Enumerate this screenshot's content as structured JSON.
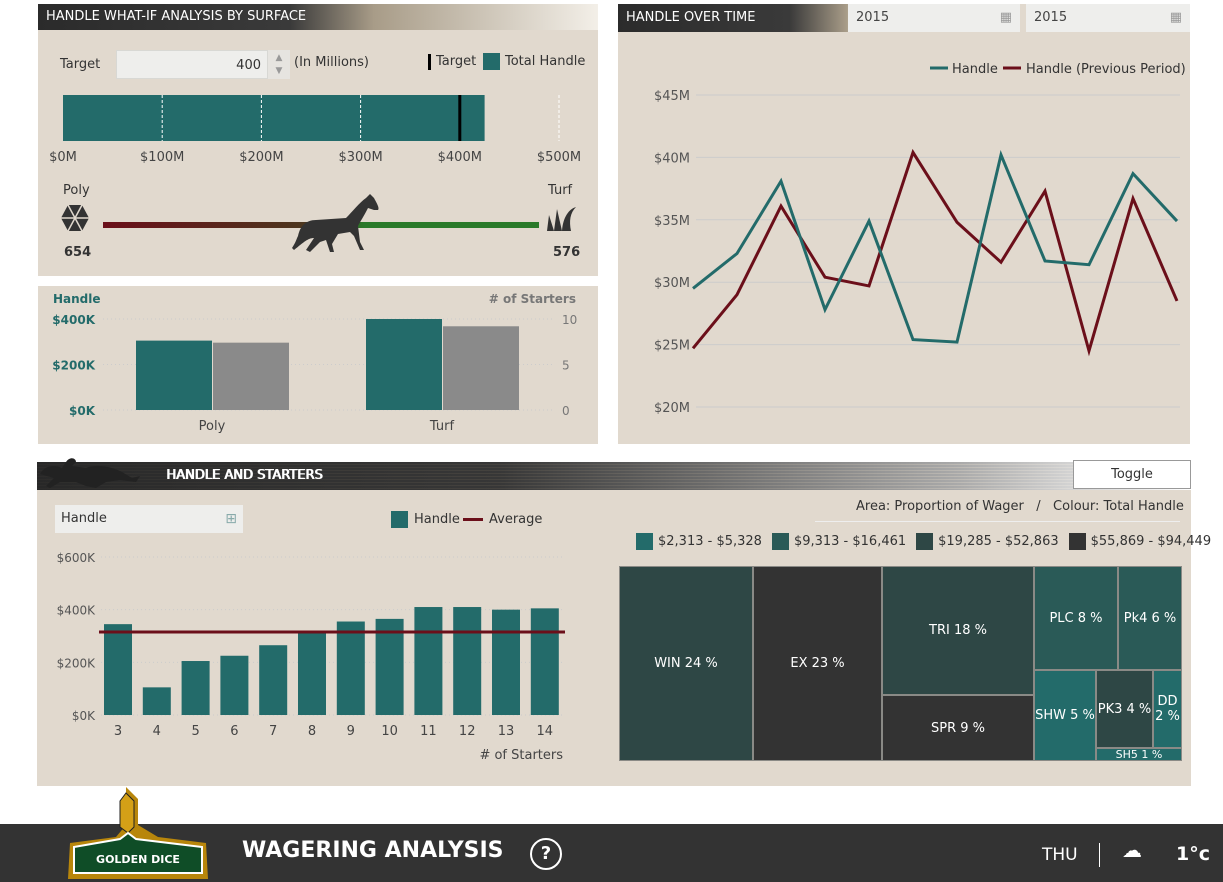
{
  "whatif": {
    "title": "HANDLE WHAT-IF ANALYSIS BY SURFACE",
    "target_label": "Target",
    "target_value": "400",
    "units": "(In Millions)",
    "legend_target": "Target",
    "legend_total": "Total Handle",
    "ticks": [
      "$0M",
      "$100M",
      "$200M",
      "$300M",
      "$400M",
      "$500M"
    ],
    "total_handle_millions": 425,
    "target_millions": 400,
    "poly_label": "Poly",
    "turf_label": "Turf",
    "poly_value": "654",
    "turf_value": "576"
  },
  "surface": {
    "left_axis_title": "Handle",
    "right_axis_title": "# of Starters",
    "left_ticks": [
      "$400K",
      "$200K",
      "$0K"
    ],
    "right_ticks": [
      "10",
      "5",
      "0"
    ],
    "categories": [
      "Poly",
      "Turf"
    ],
    "handle": [
      305000,
      400000
    ],
    "starters": [
      7.4,
      9.2
    ]
  },
  "over_time": {
    "title": "HANDLE OVER TIME",
    "date_from": "2015",
    "date_to": "2015",
    "legend": [
      "Handle",
      "Handle (Previous Period)"
    ],
    "y_ticks": [
      "$45M",
      "$40M",
      "$35M",
      "$30M",
      "$25M",
      "$20M"
    ],
    "handle": [
      29.5,
      32.3,
      38.1,
      27.8,
      34.9,
      25.4,
      25.2,
      40.2,
      31.7,
      31.4,
      38.7,
      34.9
    ],
    "previous": [
      24.7,
      29.0,
      36.1,
      30.4,
      29.7,
      40.4,
      34.8,
      31.6,
      37.3,
      24.5,
      36.7,
      28.5
    ],
    "ylim": [
      20,
      45
    ]
  },
  "starters": {
    "title": "HANDLE AND STARTERS",
    "toggle": "Toggle",
    "dropdown": "Handle",
    "legend_handle": "Handle",
    "legend_avg": "Average",
    "y_ticks": [
      "$600K",
      "$400K",
      "$200K",
      "$0K"
    ],
    "categories": [
      "3",
      "4",
      "5",
      "6",
      "7",
      "8",
      "9",
      "10",
      "11",
      "12",
      "13",
      "14"
    ],
    "values": [
      345000,
      105000,
      205000,
      225000,
      265000,
      315000,
      355000,
      365000,
      410000,
      410000,
      400000,
      405000
    ],
    "average": 315000,
    "xlabel": "# of Starters"
  },
  "treemap": {
    "caption": "Area: Proportion of Wager   /   Colour: Total Handle",
    "legend": [
      {
        "label": "$2,313 - $5,328",
        "color": "#236b6a"
      },
      {
        "label": "$9,313 - $16,461",
        "color": "#2a5a57"
      },
      {
        "label": "$19,285 - $52,863",
        "color": "#2e4745"
      },
      {
        "label": "$55,869 - $94,449",
        "color": "#333333"
      }
    ],
    "cells": [
      "WIN 24 %",
      "EX 23 %",
      "TRI 18 %",
      "SPR 9 %",
      "PLC 8 %",
      "Pk4 6 %",
      "SHW 5 %",
      "PK3 4 %",
      "DD 2 %",
      "SH5 1 %"
    ]
  },
  "footer": {
    "logo": "GOLDEN DICE",
    "title": "WAGERING ANALYSIS",
    "help": "?",
    "day": "THU",
    "temp": "1°c"
  },
  "colors": {
    "teal": "#236b6a",
    "maroon": "#6b0f1a",
    "grey": "#8a8a8a",
    "panel": "#e1d9ce"
  }
}
